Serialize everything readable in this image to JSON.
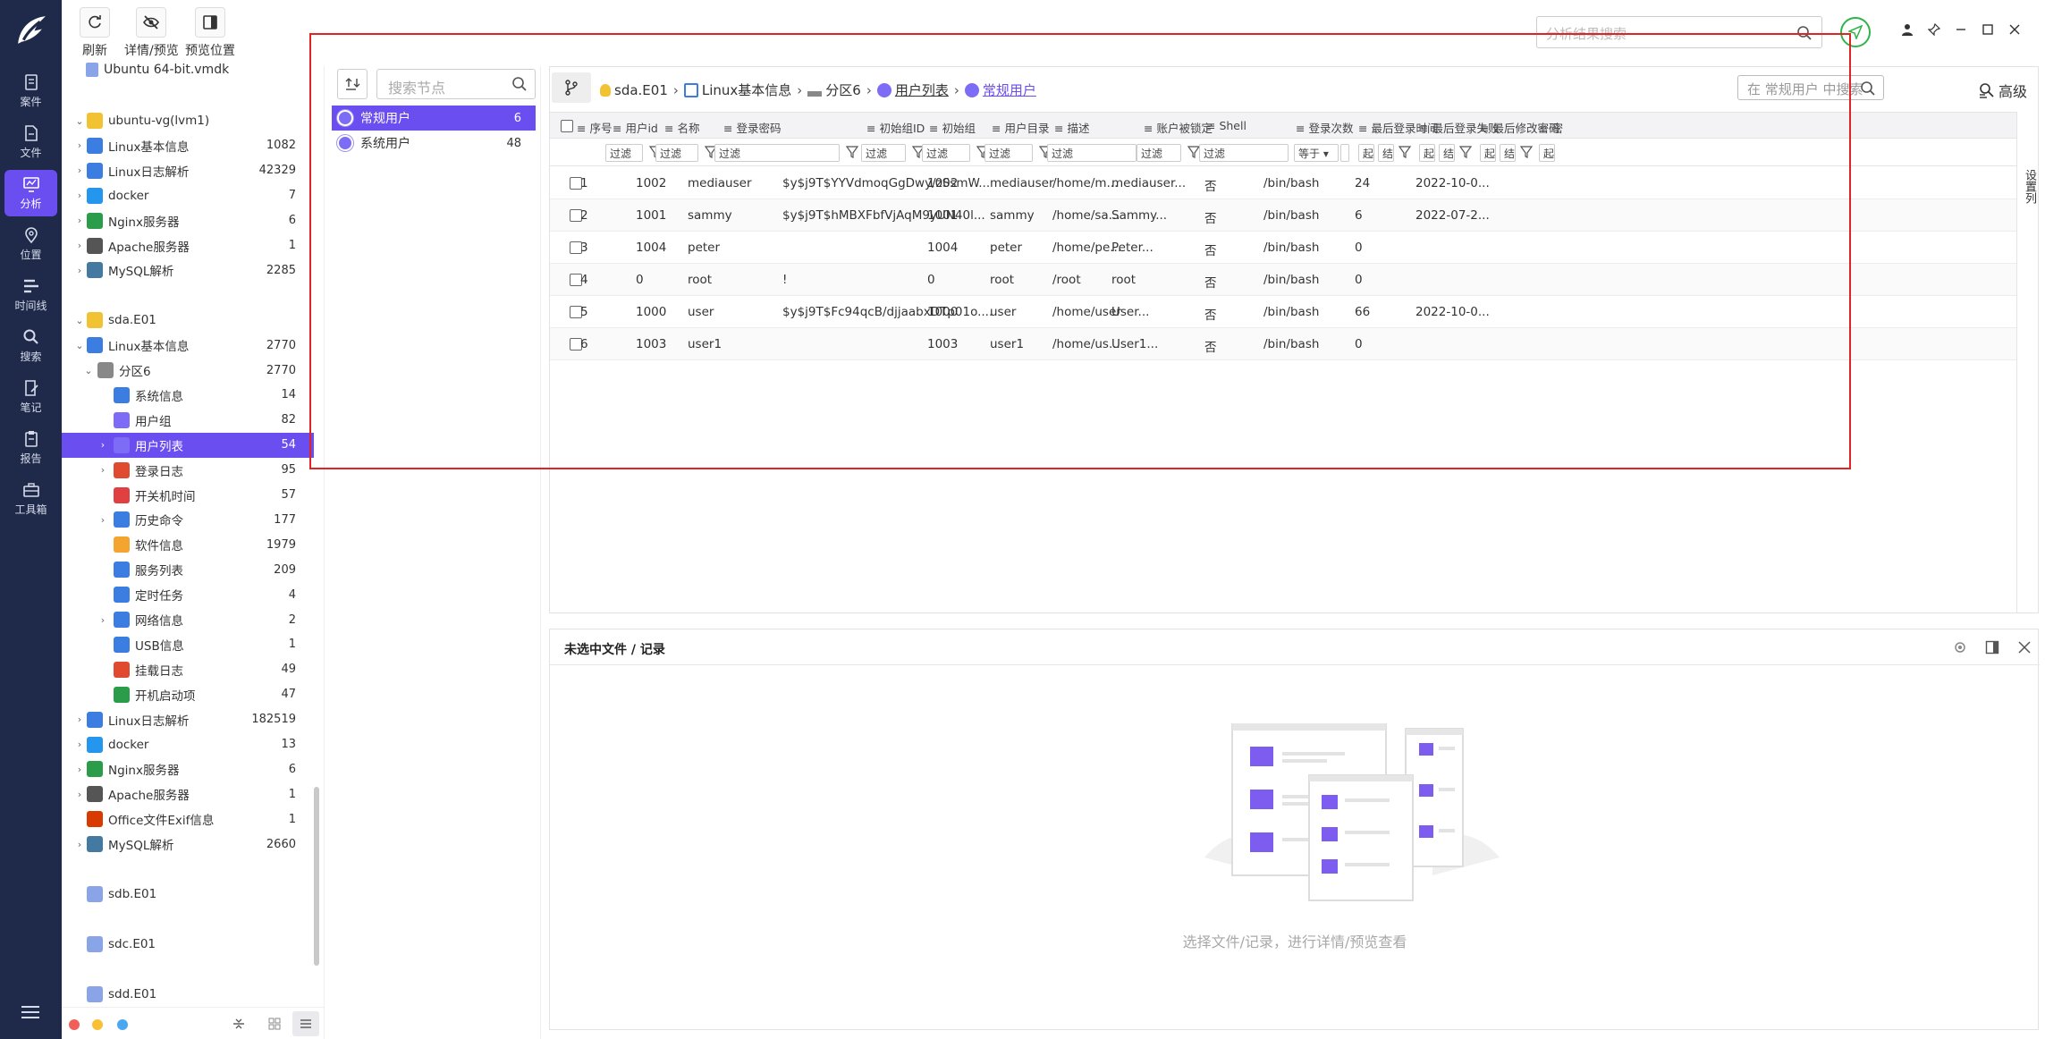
{
  "toolbar": {
    "refresh_label": "刷新",
    "details_label": "详情/预览",
    "position_label": "预览位置",
    "file_label": "Ubuntu 64-bit.vmdk"
  },
  "top_search": {
    "placeholder": "分析结果搜索"
  },
  "nav": [
    {
      "label": "案件",
      "icon": "case-icon"
    },
    {
      "label": "文件",
      "icon": "file-icon"
    },
    {
      "label": "分析",
      "icon": "analysis-icon",
      "active": true
    },
    {
      "label": "位置",
      "icon": "location-icon"
    },
    {
      "label": "时间线",
      "icon": "timeline-icon"
    },
    {
      "label": "搜索",
      "icon": "search-icon"
    },
    {
      "label": "笔记",
      "icon": "notes-icon"
    },
    {
      "label": "报告",
      "icon": "report-icon"
    },
    {
      "label": "工具箱",
      "icon": "toolbox-icon"
    }
  ],
  "tree": [
    {
      "label": "ubuntu-vg(lvm1)",
      "count": "",
      "level": 0,
      "arrow": "v",
      "icon": "linux-icon"
    },
    {
      "label": "Linux基本信息",
      "count": "1082",
      "level": 1,
      "arrow": ">",
      "icon": "info-icon"
    },
    {
      "label": "Linux日志解析",
      "count": "42329",
      "level": 1,
      "arrow": ">",
      "icon": "log-icon"
    },
    {
      "label": "docker",
      "count": "7",
      "level": 1,
      "arrow": ">",
      "icon": "docker-icon"
    },
    {
      "label": "Nginx服务器",
      "count": "6",
      "level": 1,
      "arrow": ">",
      "icon": "nginx-icon"
    },
    {
      "label": "Apache服务器",
      "count": "1",
      "level": 1,
      "arrow": ">",
      "icon": "apache-icon"
    },
    {
      "label": "MySQL解析",
      "count": "2285",
      "level": 1,
      "arrow": ">",
      "icon": "mysql-icon"
    },
    {
      "label": "",
      "count": "",
      "level": 0,
      "arrow": "",
      "icon": ""
    },
    {
      "label": "sda.E01",
      "count": "",
      "level": 0,
      "arrow": "v",
      "icon": "linux-icon"
    },
    {
      "label": "Linux基本信息",
      "count": "2770",
      "level": 1,
      "arrow": "v",
      "icon": "info-icon"
    },
    {
      "label": "分区6",
      "count": "2770",
      "level": 2,
      "arrow": "v",
      "icon": "disk-icon"
    },
    {
      "label": "系统信息",
      "count": "14",
      "level": 3,
      "arrow": "",
      "icon": "sysinfo-icon"
    },
    {
      "label": "用户组",
      "count": "82",
      "level": 3,
      "arrow": "",
      "icon": "usergroup-icon"
    },
    {
      "label": "用户列表",
      "count": "54",
      "level": 3,
      "arrow": ">",
      "icon": "userlist-icon",
      "selected": true
    },
    {
      "label": "登录日志",
      "count": "95",
      "level": 3,
      "arrow": ">",
      "icon": "login-log-icon"
    },
    {
      "label": "开关机时间",
      "count": "57",
      "level": 3,
      "arrow": "",
      "icon": "power-icon"
    },
    {
      "label": "历史命令",
      "count": "177",
      "level": 3,
      "arrow": ">",
      "icon": "history-icon"
    },
    {
      "label": "软件信息",
      "count": "1979",
      "level": 3,
      "arrow": "",
      "icon": "software-icon"
    },
    {
      "label": "服务列表",
      "count": "209",
      "level": 3,
      "arrow": "",
      "icon": "service-icon"
    },
    {
      "label": "定时任务",
      "count": "4",
      "level": 3,
      "arrow": "",
      "icon": "cron-icon"
    },
    {
      "label": "网络信息",
      "count": "2",
      "level": 3,
      "arrow": ">",
      "icon": "network-icon"
    },
    {
      "label": "USB信息",
      "count": "1",
      "level": 3,
      "arrow": "",
      "icon": "usb-icon"
    },
    {
      "label": "挂载日志",
      "count": "49",
      "level": 3,
      "arrow": "",
      "icon": "mount-icon"
    },
    {
      "label": "开机启动项",
      "count": "47",
      "level": 3,
      "arrow": "",
      "icon": "startup-icon"
    },
    {
      "label": "Linux日志解析",
      "count": "182519",
      "level": 1,
      "arrow": ">",
      "icon": "log-icon"
    },
    {
      "label": "docker",
      "count": "13",
      "level": 1,
      "arrow": ">",
      "icon": "docker-icon"
    },
    {
      "label": "Nginx服务器",
      "count": "6",
      "level": 1,
      "arrow": ">",
      "icon": "nginx-icon"
    },
    {
      "label": "Apache服务器",
      "count": "1",
      "level": 1,
      "arrow": ">",
      "icon": "apache-icon"
    },
    {
      "label": "Office文件Exif信息",
      "count": "1",
      "level": 1,
      "arrow": "",
      "icon": "office-icon"
    },
    {
      "label": "MySQL解析",
      "count": "2660",
      "level": 1,
      "arrow": ">",
      "icon": "mysql-icon"
    },
    {
      "label": "",
      "count": "",
      "level": 0,
      "arrow": "",
      "icon": ""
    },
    {
      "label": "sdb.E01",
      "count": "",
      "level": 0,
      "arrow": "",
      "icon": "image-file-icon"
    },
    {
      "label": "",
      "count": "",
      "level": 0,
      "arrow": "",
      "icon": ""
    },
    {
      "label": "sdc.E01",
      "count": "",
      "level": 0,
      "arrow": "",
      "icon": "image-file-icon"
    },
    {
      "label": "",
      "count": "",
      "level": 0,
      "arrow": "",
      "icon": ""
    },
    {
      "label": "sdd.E01",
      "count": "",
      "level": 0,
      "arrow": "",
      "icon": "image-file-icon"
    }
  ],
  "nodes": {
    "search_placeholder": "搜索节点",
    "items": [
      {
        "label": "常规用户",
        "count": "6",
        "selected": true
      },
      {
        "label": "系统用户",
        "count": "48"
      }
    ]
  },
  "breadcrumb": {
    "items": [
      "sda.E01",
      "Linux基本信息",
      "分区6",
      "用户列表",
      "常规用户"
    ],
    "search_placeholder": "在 常规用户 中搜索",
    "advanced_label": "高级"
  },
  "grid": {
    "columns": [
      "序号",
      "用户id",
      "名称",
      "登录密码",
      "初始组ID",
      "初始组",
      "用户目录",
      "描述",
      "账户被锁定",
      "Shell",
      "登录次数",
      "最后登录时间",
      "最后登录失败",
      "最后修改密码",
      "密"
    ],
    "filter_label": "过滤",
    "equals_label": "等于",
    "start_label": "起",
    "end_label": "结",
    "settings_label": "设置列",
    "rows": [
      [
        "1",
        "1002",
        "mediauser",
        "$y$j9T$YYVdmoqGgDwy/zSsmW...",
        "1002",
        "mediauser",
        "/home/m...",
        "mediauser...",
        "否",
        "/bin/bash",
        "24",
        "2022-10-0..."
      ],
      [
        "2",
        "1001",
        "sammy",
        "$y$j9T$hMBXFbfVjAqM9yUN40l...",
        "1001",
        "sammy",
        "/home/sa...",
        "Sammy...",
        "否",
        "/bin/bash",
        "6",
        "2022-07-2..."
      ],
      [
        "3",
        "1004",
        "peter",
        "",
        "1004",
        "peter",
        "/home/pe...",
        "Peter...",
        "否",
        "/bin/bash",
        "0",
        ""
      ],
      [
        "4",
        "0",
        "root",
        "!",
        "0",
        "root",
        "/root",
        "root",
        "否",
        "/bin/bash",
        "0",
        ""
      ],
      [
        "5",
        "1000",
        "user",
        "$y$j9T$Fc94qcB/djjaabxDTp01o....",
        "1000",
        "user",
        "/home/user",
        "User...",
        "否",
        "/bin/bash",
        "66",
        "2022-10-0..."
      ],
      [
        "6",
        "1003",
        "user1",
        "",
        "1003",
        "user1",
        "/home/us...",
        "User1...",
        "否",
        "/bin/bash",
        "0",
        ""
      ]
    ]
  },
  "preview": {
    "title": "未选中文件 / 记录",
    "empty_message": "选择文件/记录，进行详情/预览查看"
  },
  "colors": {
    "accent": "#6b4ef0",
    "nav_bg": "#1f2a4a",
    "highlight_box": "#e02424",
    "circle_btn": "#2fb34a"
  }
}
